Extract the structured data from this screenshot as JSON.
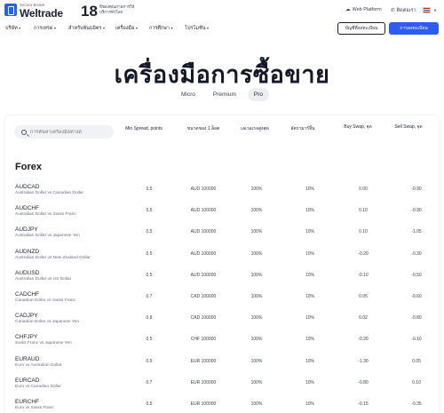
{
  "header": {
    "logo_small": "Secure Broker",
    "logo_text": "Weltrade",
    "years_number": "18",
    "years_text": "ปีของคุณภาพการให้บริการทั่วโลก",
    "web_platform": "Web Platform",
    "call_us": "ติดต่อเรา",
    "language_flag": "Thai flag"
  },
  "nav": {
    "items": [
      "บริษัท",
      "การเทรด",
      "สำหรับพันธมิตร",
      "เครื่องมือ",
      "การศึกษา",
      "โปรโมชั่น"
    ],
    "open_account": "บัญชีที่ลงทะเบียน",
    "login": "การลงทะเบียน"
  },
  "page_title": "เครื่องมือการซื้อขาย",
  "account_tabs": [
    "Micro",
    "Premium",
    "Pro"
  ],
  "active_tab": "Pro",
  "table": {
    "search_placeholder": "การค้นหาเครื่องมือทางด์",
    "columns": [
      "Min Spread, points",
      "ขนาดของ 1 ล็อต",
      "เลเวอเรจสูงสุด",
      "อัตรามาร์จิ้น",
      "Buy Swap, จุด",
      "Sell Swap, จุด"
    ],
    "section": "Forex",
    "rows": [
      {
        "symbol": "AUDCAD",
        "name": "Australian Dollar vs Canadian Dollar",
        "spread": "0.5",
        "lot": "AUD 100000",
        "leverage": "100%",
        "margin": "10%",
        "buy": "0.00",
        "sell": "-0.90"
      },
      {
        "symbol": "AUDCHF",
        "name": "Australian Dollar vs Swiss Franc",
        "spread": "0.5",
        "lot": "AUD 100000",
        "leverage": "100%",
        "margin": "10%",
        "buy": "0.10",
        "sell": "-0.90"
      },
      {
        "symbol": "AUDJPY",
        "name": "Australian Dollar vs Japanese Yen",
        "spread": "0.5",
        "lot": "AUD 100000",
        "leverage": "100%",
        "margin": "10%",
        "buy": "0.10",
        "sell": "-1.05"
      },
      {
        "symbol": "AUDNZD",
        "name": "Australian Dollar vs New Zealand Dollar",
        "spread": "0.5",
        "lot": "AUD 100000",
        "leverage": "100%",
        "margin": "10%",
        "buy": "-0.20",
        "sell": "-0.30"
      },
      {
        "symbol": "AUDUSD",
        "name": "Australian Dollar vs US Dollar",
        "spread": "0.5",
        "lot": "AUD 100000",
        "leverage": "100%",
        "margin": "10%",
        "buy": "-0.10",
        "sell": "-0.50"
      },
      {
        "symbol": "CADCHF",
        "name": "Canadian Dollar vs Swiss Franc",
        "spread": "0.7",
        "lot": "CAD 100000",
        "leverage": "100%",
        "margin": "10%",
        "buy": "0.05",
        "sell": "-0.60"
      },
      {
        "symbol": "CADJPY",
        "name": "Canadian Dollar vs Japanese Yen",
        "spread": "0.8",
        "lot": "CAD 100000",
        "leverage": "100%",
        "margin": "10%",
        "buy": "0.02",
        "sell": "-0.80"
      },
      {
        "symbol": "CHFJPY",
        "name": "Swiss Franc vs Japanese Yen",
        "spread": "0.5",
        "lot": "CHF 100000",
        "leverage": "100%",
        "margin": "10%",
        "buy": "-0.20",
        "sell": "-0.10"
      },
      {
        "symbol": "EURAUD",
        "name": "Euro vs Australian Dollar",
        "spread": "0.5",
        "lot": "EUR 100000",
        "leverage": "100%",
        "margin": "10%",
        "buy": "-1.30",
        "sell": "0.05"
      },
      {
        "symbol": "EURCAD",
        "name": "Euro vs Canadian Dollar",
        "spread": "0.7",
        "lot": "EUR 100000",
        "leverage": "100%",
        "margin": "10%",
        "buy": "-0.80",
        "sell": "0.10"
      },
      {
        "symbol": "EURCHF",
        "name": "Euro vs Swiss Franc",
        "spread": "0.5",
        "lot": "EUR 100000",
        "leverage": "100%",
        "margin": "10%",
        "buy": "-0.15",
        "sell": "-0.35"
      }
    ]
  },
  "colors": {
    "accent": "#2d5df0",
    "text": "#1c2033",
    "muted": "#6a6f82"
  }
}
